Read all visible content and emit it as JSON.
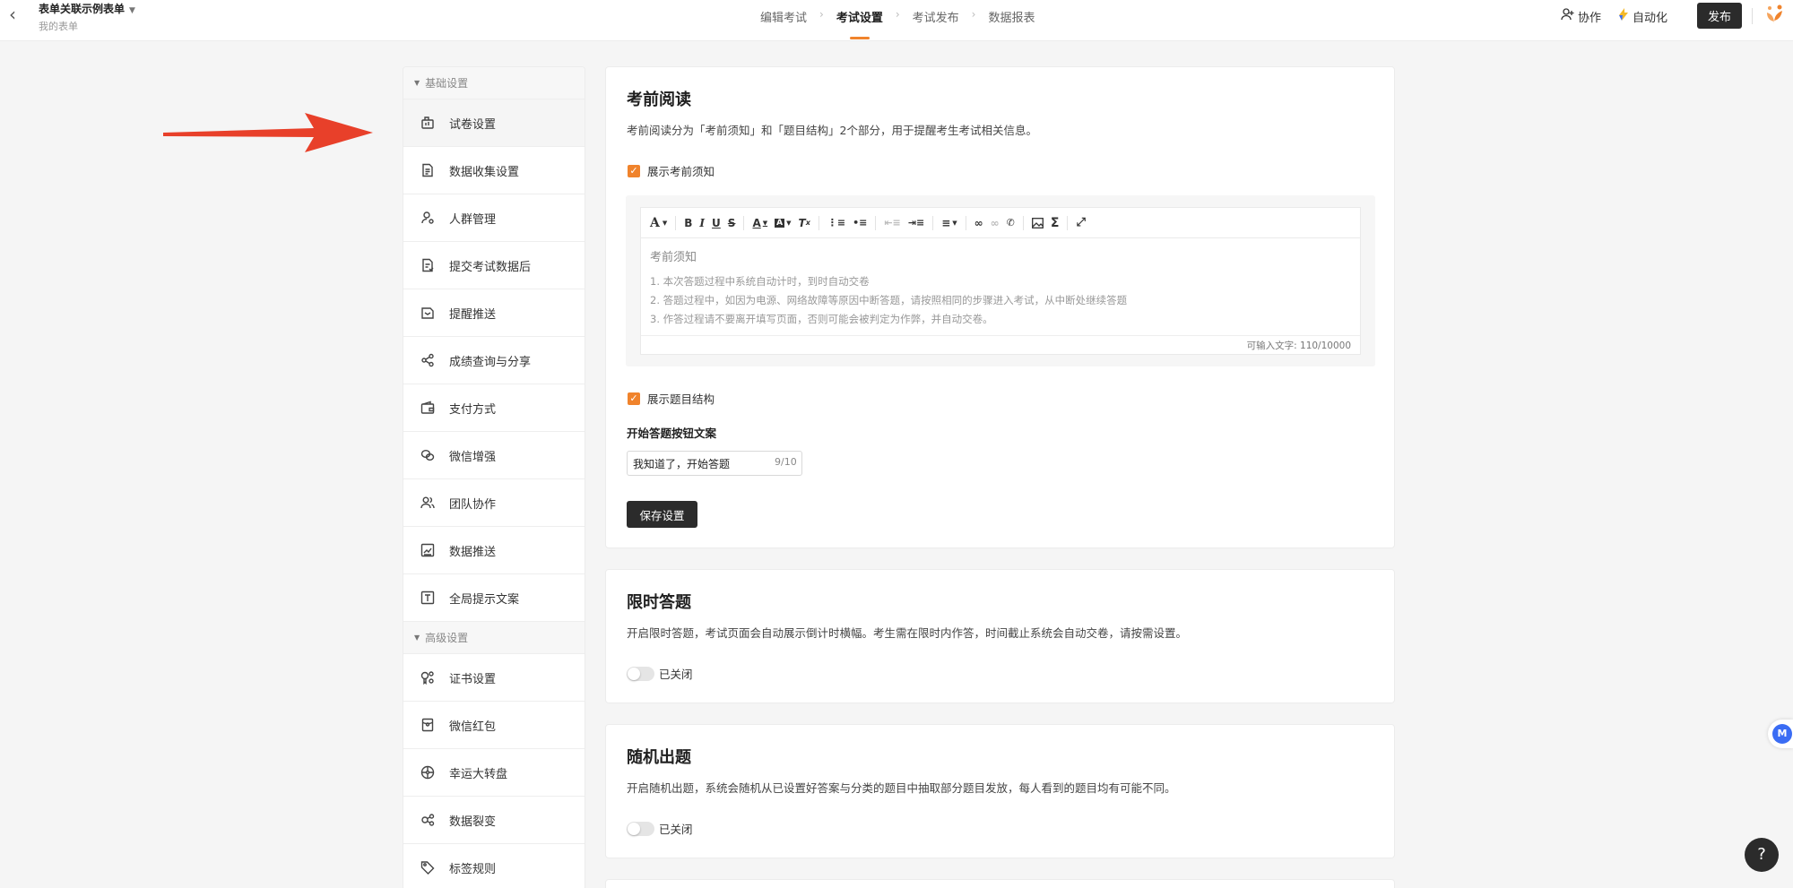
{
  "header": {
    "form_title": "表单关联示例表单",
    "form_subtitle": "我的表单",
    "steps": [
      {
        "label": "编辑考试",
        "active": false
      },
      {
        "label": "考试设置",
        "active": true
      },
      {
        "label": "考试发布",
        "active": false
      },
      {
        "label": "数据报表",
        "active": false
      }
    ],
    "collaborate_label": "协作",
    "automation_label": "自动化",
    "publish_label": "发布"
  },
  "sidebar": {
    "group_basic": "基础设置",
    "basic_items": [
      {
        "label": "试卷设置",
        "icon": "paper-settings-icon",
        "active": true
      },
      {
        "label": "数据收集设置",
        "icon": "document-icon"
      },
      {
        "label": "人群管理",
        "icon": "user-group-icon"
      },
      {
        "label": "提交考试数据后",
        "icon": "submit-doc-icon"
      },
      {
        "label": "提醒推送",
        "icon": "reminder-icon"
      },
      {
        "label": "成绩查询与分享",
        "icon": "share-icon"
      },
      {
        "label": "支付方式",
        "icon": "wallet-icon"
      },
      {
        "label": "微信增强",
        "icon": "wechat-icon"
      },
      {
        "label": "团队协作",
        "icon": "team-icon"
      },
      {
        "label": "数据推送",
        "icon": "chart-push-icon"
      },
      {
        "label": "全局提示文案",
        "icon": "text-icon"
      }
    ],
    "group_advanced": "高级设置",
    "advanced_items": [
      {
        "label": "证书设置",
        "icon": "certificate-icon"
      },
      {
        "label": "微信红包",
        "icon": "red-packet-icon"
      },
      {
        "label": "幸运大转盘",
        "icon": "wheel-icon"
      },
      {
        "label": "数据裂变",
        "icon": "fission-icon"
      },
      {
        "label": "标签规则",
        "icon": "tag-icon"
      }
    ]
  },
  "pre_reading": {
    "title": "考前阅读",
    "description": "考前阅读分为「考前须知」和「题目结构」2个部分，用于提醒考生考试相关信息。",
    "show_notice_label": "展示考前须知",
    "show_notice_checked": true,
    "editor": {
      "heading": "考前须知",
      "lines": [
        "1. 本次答题过程中系统自动计时，到时自动交卷",
        "2. 答题过程中，如因为电源、网络故障等原因中断答题，请按照相同的步骤进入考试，从中断处继续答题",
        "3. 作答过程请不要离开填写页面，否则可能会被判定为作弊，并自动交卷。"
      ],
      "char_count": "可输入文字: 110/10000"
    },
    "show_structure_label": "展示题目结构",
    "show_structure_checked": true,
    "start_button_label_title": "开始答题按钮文案",
    "start_button_value": "我知道了，开始答题",
    "start_button_count": "9/10",
    "save_label": "保存设置"
  },
  "timed": {
    "title": "限时答题",
    "description": "开启限时答题，考试页面会自动展示倒计时横幅。考生需在限时内作答，时间截止系统会自动交卷，请按需设置。",
    "toggle_label": "已关闭",
    "enabled": false
  },
  "random": {
    "title": "随机出题",
    "description": "开启随机出题，系统会随机从已设置好答案与分类的题目中抽取部分题目发放，每人看到的题目均有可能不同。",
    "toggle_label": "已关闭",
    "enabled": false
  },
  "help_label": "?",
  "colors": {
    "accent": "#f0832c",
    "dark": "#2b2b2b",
    "arrow": "#e8402a"
  }
}
